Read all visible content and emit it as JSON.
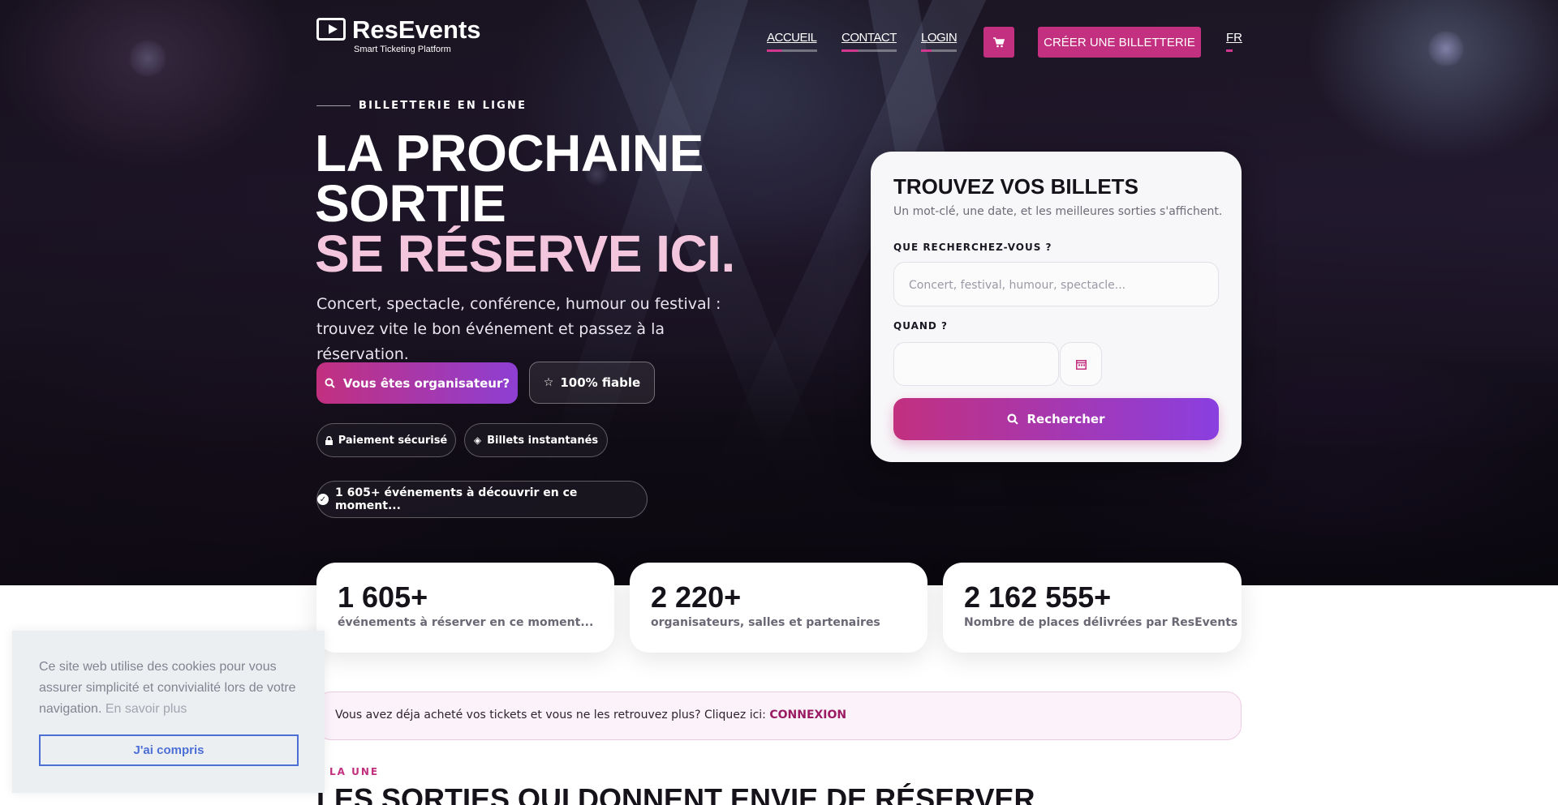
{
  "header": {
    "brand": "ResEvents",
    "tagline": "Smart Ticketing Platform",
    "nav": [
      "ACCUEIL",
      "CONTACT",
      "LOGIN"
    ],
    "cart_icon": "cart-icon",
    "create_label": "CRÉER UNE BILLETTERIE",
    "lang": "FR"
  },
  "hero": {
    "kicker": "BILLETTERIE EN LIGNE",
    "title_line1": "LA PROCHAINE",
    "title_line2": "SORTIE",
    "title_line3": "SE RÉSERVE ICI.",
    "lead_line1": "Concert, spectacle, conférence, humour ou festival :",
    "lead_line2": "trouvez vite le bon événement et passez à la réservation.",
    "organizer_button": "Vous êtes organisateur?",
    "trust_button": "100% fiable",
    "pill_secure": "Paiement sécurisé",
    "pill_instant": "Billets instantanés",
    "events_pill": "1 605+ événements à découvrir en ce moment..."
  },
  "search": {
    "title": "TROUVEZ VOS BILLETS",
    "subtitle": "Un mot-clé, une date, et les meilleures sorties s'affichent.",
    "what_label": "QUE RECHERCHEZ-VOUS ?",
    "what_placeholder": "Concert, festival, humour, spectacle...",
    "when_label": "QUAND ?",
    "date_value": "",
    "submit": "Rechercher"
  },
  "stats": [
    {
      "num": "1 605+",
      "cap": "événements à réserver en ce moment..."
    },
    {
      "num": "2 220+",
      "cap": "organisateurs, salles et partenaires"
    },
    {
      "num": "2 162 555+",
      "cap": "Nombre de places délivrées par ResEvents"
    }
  ],
  "notice": {
    "text": "Vous avez déja acheté vos tickets et vous ne les retrouvez plus? Cliquez ici: ",
    "link": "CONNEXION"
  },
  "section": {
    "kicker": "LA UNE",
    "title": "LES SORTIES QUI DONNENT ENVIE DE RÉSERVER"
  },
  "cookie": {
    "message": "Ce site web utilise des cookies pour vous assurer simplicité et convivialité lors de votre navigation.",
    "learn_more": "En savoir plus",
    "accept": "J'ai compris"
  },
  "colors": {
    "accent": "#c2307f",
    "accent_purple": "#8a3fe0",
    "cookie_button": "#4c6fd6"
  }
}
